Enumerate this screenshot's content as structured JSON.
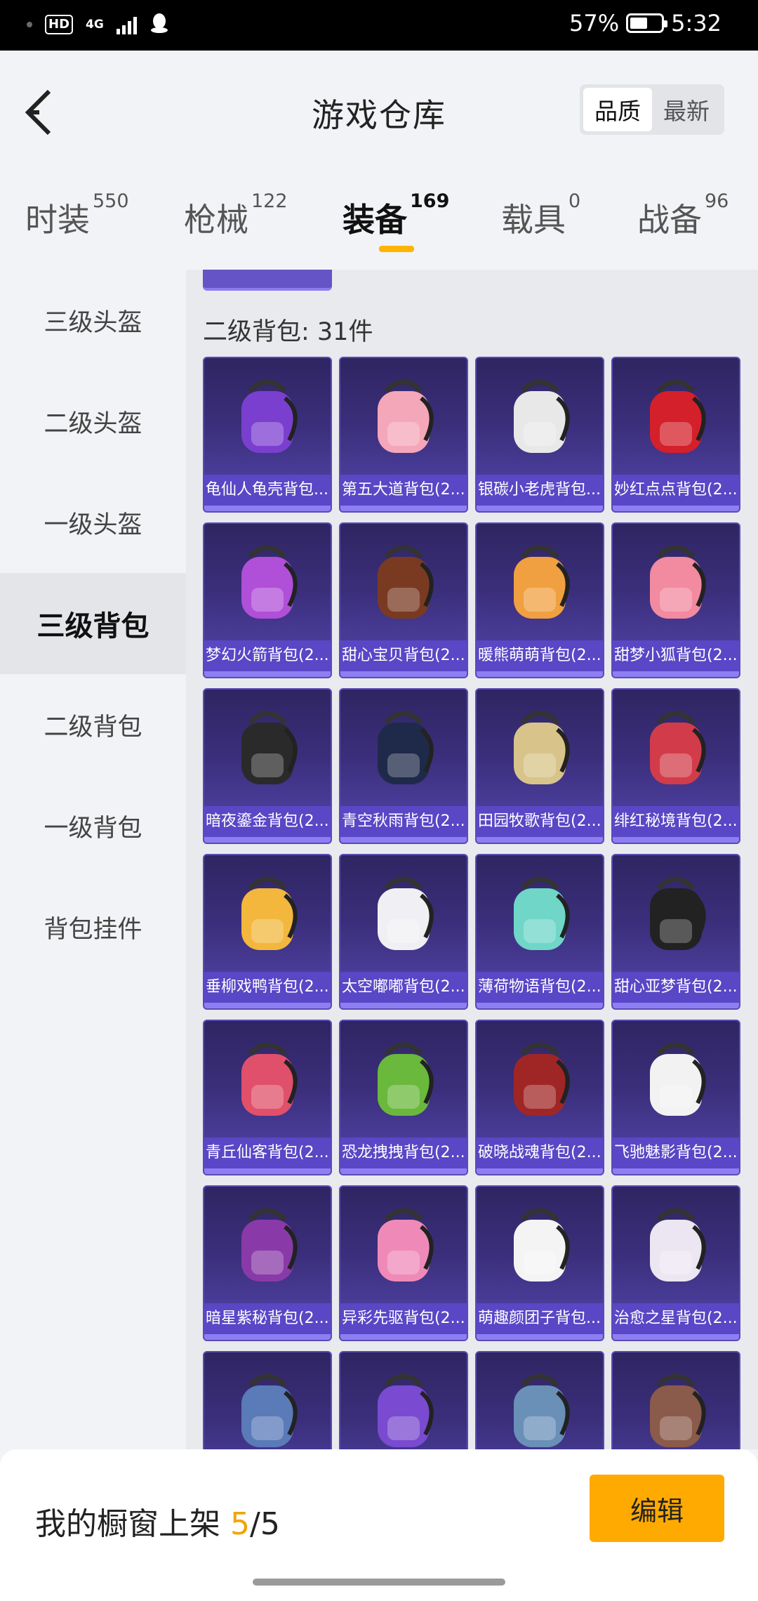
{
  "status_bar": {
    "network": "4G",
    "hd": "HD",
    "battery_percent": "57%",
    "battery_level": 0.57,
    "time": "5:32"
  },
  "header": {
    "title": "游戏仓库",
    "sort_options": [
      "品质",
      "最新"
    ],
    "sort_selected": "品质"
  },
  "tabs": [
    {
      "label": "时装",
      "count": "550"
    },
    {
      "label": "枪械",
      "count": "122"
    },
    {
      "label": "装备",
      "count": "169"
    },
    {
      "label": "载具",
      "count": "0"
    },
    {
      "label": "战备",
      "count": "96"
    }
  ],
  "active_tab": "装备",
  "sidebar": {
    "items": [
      "三级头盔",
      "二级头盔",
      "一级头盔",
      "三级背包",
      "二级背包",
      "一级背包",
      "背包挂件"
    ],
    "active": "三级背包"
  },
  "section": {
    "title": "二级背包: 31件"
  },
  "items": [
    {
      "name": "龟仙人龟壳背包...",
      "icon": "turtle-shell-backpack-icon",
      "color": "#7b3fd0"
    },
    {
      "name": "第五大道背包(2...",
      "icon": "pink-handbag-backpack-icon",
      "color": "#f4a7b9"
    },
    {
      "name": "银碳小老虎背包...",
      "icon": "tiger-backpack-icon",
      "color": "#e8e8e8"
    },
    {
      "name": "妙红点点背包(2...",
      "icon": "ladybug-backpack-icon",
      "color": "#d4202a"
    },
    {
      "name": "梦幻火箭背包(2...",
      "icon": "rocket-backpack-icon",
      "color": "#b04fd8"
    },
    {
      "name": "甜心宝贝背包(2...",
      "icon": "cupcake-backpack-icon",
      "color": "#7a3a22"
    },
    {
      "name": "暖熊萌萌背包(2...",
      "icon": "fox-basket-backpack-icon",
      "color": "#f0a040"
    },
    {
      "name": "甜梦小狐背包(2...",
      "icon": "pink-fox-backpack-icon",
      "color": "#f28aa0"
    },
    {
      "name": "暗夜鎏金背包(2...",
      "icon": "black-gold-backpack-icon",
      "color": "#2a2a2a"
    },
    {
      "name": "青空秋雨背包(2...",
      "icon": "navy-backpack-icon",
      "color": "#1f2a4a"
    },
    {
      "name": "田园牧歌背包(2...",
      "icon": "picnic-basket-backpack-icon",
      "color": "#d8c48a"
    },
    {
      "name": "绯红秘境背包(2...",
      "icon": "striped-red-backpack-icon",
      "color": "#d23c4a"
    },
    {
      "name": "垂柳戏鸭背包(2...",
      "icon": "duck-backpack-icon",
      "color": "#f2b73c"
    },
    {
      "name": "太空嘟嘟背包(2...",
      "icon": "space-helmet-backpack-icon",
      "color": "#f0f0f4"
    },
    {
      "name": "薄荷物语背包(2...",
      "icon": "mint-school-backpack-icon",
      "color": "#6fd6c8"
    },
    {
      "name": "甜心亚梦背包(2...",
      "icon": "black-cat-backpack-icon",
      "color": "#222222"
    },
    {
      "name": "青丘仙客背包(2...",
      "icon": "bow-heart-backpack-icon",
      "color": "#e0506a"
    },
    {
      "name": "恐龙拽拽背包(2...",
      "icon": "dino-hood-backpack-icon",
      "color": "#6ab83c"
    },
    {
      "name": "破晓战魂背包(2...",
      "icon": "dark-warrior-backpack-icon",
      "color": "#a02626"
    },
    {
      "name": "飞驰魅影背包(2...",
      "icon": "white-racer-backpack-icon",
      "color": "#f2f2f2"
    },
    {
      "name": "暗星紫秘背包(2...",
      "icon": "purple-armor-backpack-icon",
      "color": "#8a3aa8"
    },
    {
      "name": "异彩先驱背包(2...",
      "icon": "doodle-backpack-icon",
      "color": "#ef8ab8"
    },
    {
      "name": "萌趣颜团子背包...",
      "icon": "bunny-backpack-icon",
      "color": "#f4f4f4"
    },
    {
      "name": "治愈之星背包(2...",
      "icon": "white-pink-backpack-icon",
      "color": "#ece6f2"
    },
    {
      "name": "",
      "icon": "tv-backpack-icon",
      "color": "#5a7ab8"
    },
    {
      "name": "",
      "icon": "monster-backpack-icon",
      "color": "#7a4ad0"
    },
    {
      "name": "",
      "icon": "denim-backpack-icon",
      "color": "#6a90b8"
    },
    {
      "name": "",
      "icon": "brown-hiker-backpack-icon",
      "color": "#8a5a4a"
    }
  ],
  "bottom_bar": {
    "label": "我的橱窗上架",
    "current": "5",
    "separator": "/",
    "total": "5",
    "edit_label": "编辑"
  },
  "colors": {
    "accent": "#ffaa00",
    "card_purple": "#5a48c8"
  }
}
